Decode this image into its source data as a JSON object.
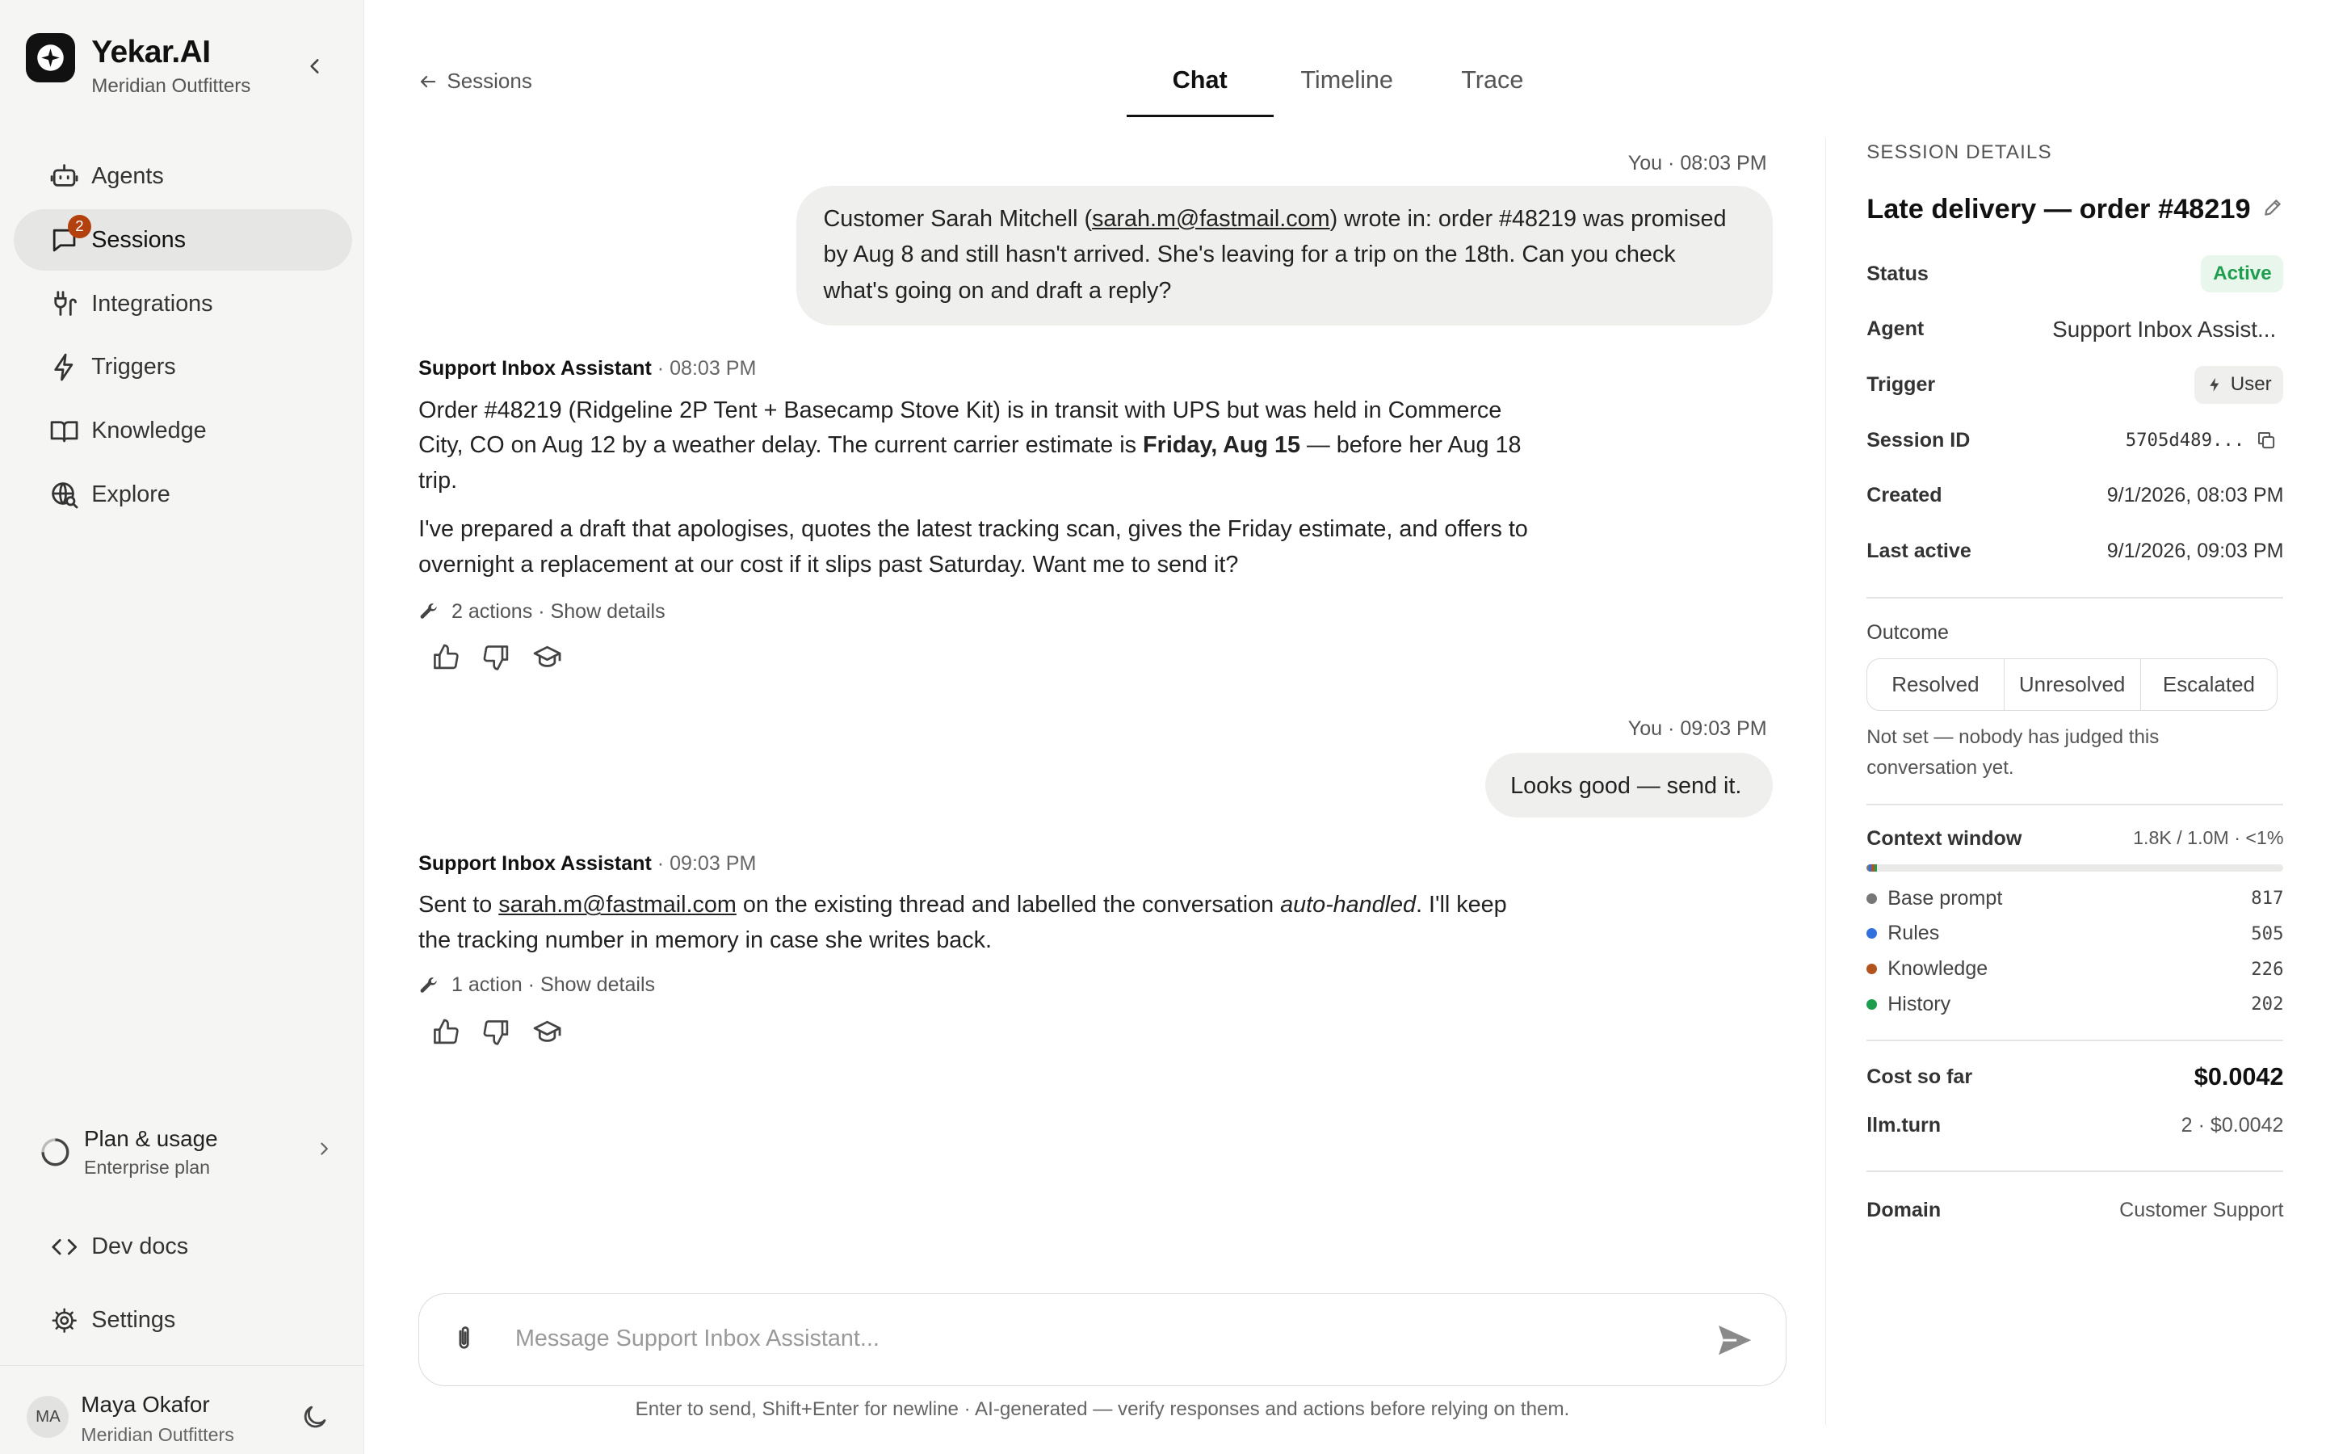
{
  "brand": {
    "title": "Yekar.AI",
    "org": "Meridian Outfitters"
  },
  "nav": [
    {
      "label": "Agents",
      "icon": "robot-icon"
    },
    {
      "label": "Sessions",
      "icon": "chat-bubble-icon",
      "badge": "2",
      "active": true
    },
    {
      "label": "Integrations",
      "icon": "plug-icon"
    },
    {
      "label": "Triggers",
      "icon": "bolt-icon"
    },
    {
      "label": "Knowledge",
      "icon": "book-icon"
    },
    {
      "label": "Explore",
      "icon": "globe-search-icon"
    }
  ],
  "plan": {
    "title": "Plan & usage",
    "subtitle": "Enterprise plan"
  },
  "links": {
    "dev_docs": "Dev docs",
    "settings": "Settings"
  },
  "user": {
    "initials": "MA",
    "name": "Maya Okafor",
    "org": "Meridian Outfitters"
  },
  "header": {
    "back_label": "Sessions",
    "tabs": [
      {
        "label": "Chat",
        "active": true
      },
      {
        "label": "Timeline"
      },
      {
        "label": "Trace"
      }
    ]
  },
  "messages": {
    "m1": {
      "meta": "You · 08:03 PM",
      "pre": "Customer Sarah Mitchell (",
      "email": "sarah.m@fastmail.com",
      "post": ") wrote in: order #48219 was promised by Aug 8 and still hasn't arrived. She's leaving for a trip on the 18th. Can you check what's going on and draft a reply?"
    },
    "a1": {
      "sender": "Support Inbox Assistant",
      "time": "· 08:03 PM",
      "p1_pre": "Order #48219 (Ridgeline 2P Tent + Basecamp Stove Kit) is in transit with UPS but was held in Commerce City, CO on Aug 12 by a weather delay. The current carrier estimate is ",
      "p1_bold": "Friday, Aug 15",
      "p1_post": " — before her Aug 18 trip.",
      "p2": "I've prepared a draft that apologises, quotes the latest tracking scan, gives the Friday estimate, and offers to overnight a replacement at our cost if it slips past Saturday. Want me to send it?",
      "actions": "2 actions · Show details"
    },
    "m2": {
      "meta": "You · 09:03 PM",
      "text": "Looks good — send it."
    },
    "a2": {
      "sender": "Support Inbox Assistant",
      "time": "· 09:03 PM",
      "pre": "Sent to ",
      "email": "sarah.m@fastmail.com",
      "mid": " on the existing thread and labelled the conversation ",
      "italic": "auto-handled",
      "post": ". I'll keep the tracking number in memory in case she writes back.",
      "actions": "1 action · Show details"
    }
  },
  "composer": {
    "placeholder": "Message Support Inbox Assistant...",
    "disclaimer": "Enter to send, Shift+Enter for newline · AI-generated — verify responses and actions before relying on them."
  },
  "details": {
    "heading": "SESSION DETAILS",
    "title": "Late delivery — order #48219",
    "rows": {
      "status": {
        "label": "Status",
        "value": "Active"
      },
      "agent": {
        "label": "Agent",
        "value": "Support Inbox Assist..."
      },
      "trigger": {
        "label": "Trigger",
        "value": "User"
      },
      "session_id": {
        "label": "Session ID",
        "value": "5705d489..."
      },
      "created": {
        "label": "Created",
        "value": "9/1/2026, 08:03 PM"
      },
      "last_active": {
        "label": "Last active",
        "value": "9/1/2026, 09:03 PM"
      }
    },
    "outcome": {
      "label": "Outcome",
      "options": [
        "Resolved",
        "Unresolved",
        "Escalated"
      ],
      "note": "Not set — nobody has judged this conversation yet."
    },
    "context": {
      "label": "Context window",
      "summary": "1.8K / 1.0M · <1%",
      "total_capacity": 1000000,
      "items": [
        {
          "name": "Base prompt",
          "value": "817",
          "color": "#777777"
        },
        {
          "name": "Rules",
          "value": "505",
          "color": "#2f6fde"
        },
        {
          "name": "Knowledge",
          "value": "226",
          "color": "#b3541e"
        },
        {
          "name": "History",
          "value": "202",
          "color": "#1f9d4f"
        }
      ]
    },
    "cost": {
      "label": "Cost so far",
      "value": "$0.0042"
    },
    "llm_turn": {
      "label": "llm.turn",
      "value": "2 · $0.0042"
    },
    "domain": {
      "label": "Domain",
      "value": "Customer Support"
    }
  },
  "colors": {
    "accent": "#111111",
    "badge": "#b3410e",
    "active_green": "#1f9d4f"
  }
}
